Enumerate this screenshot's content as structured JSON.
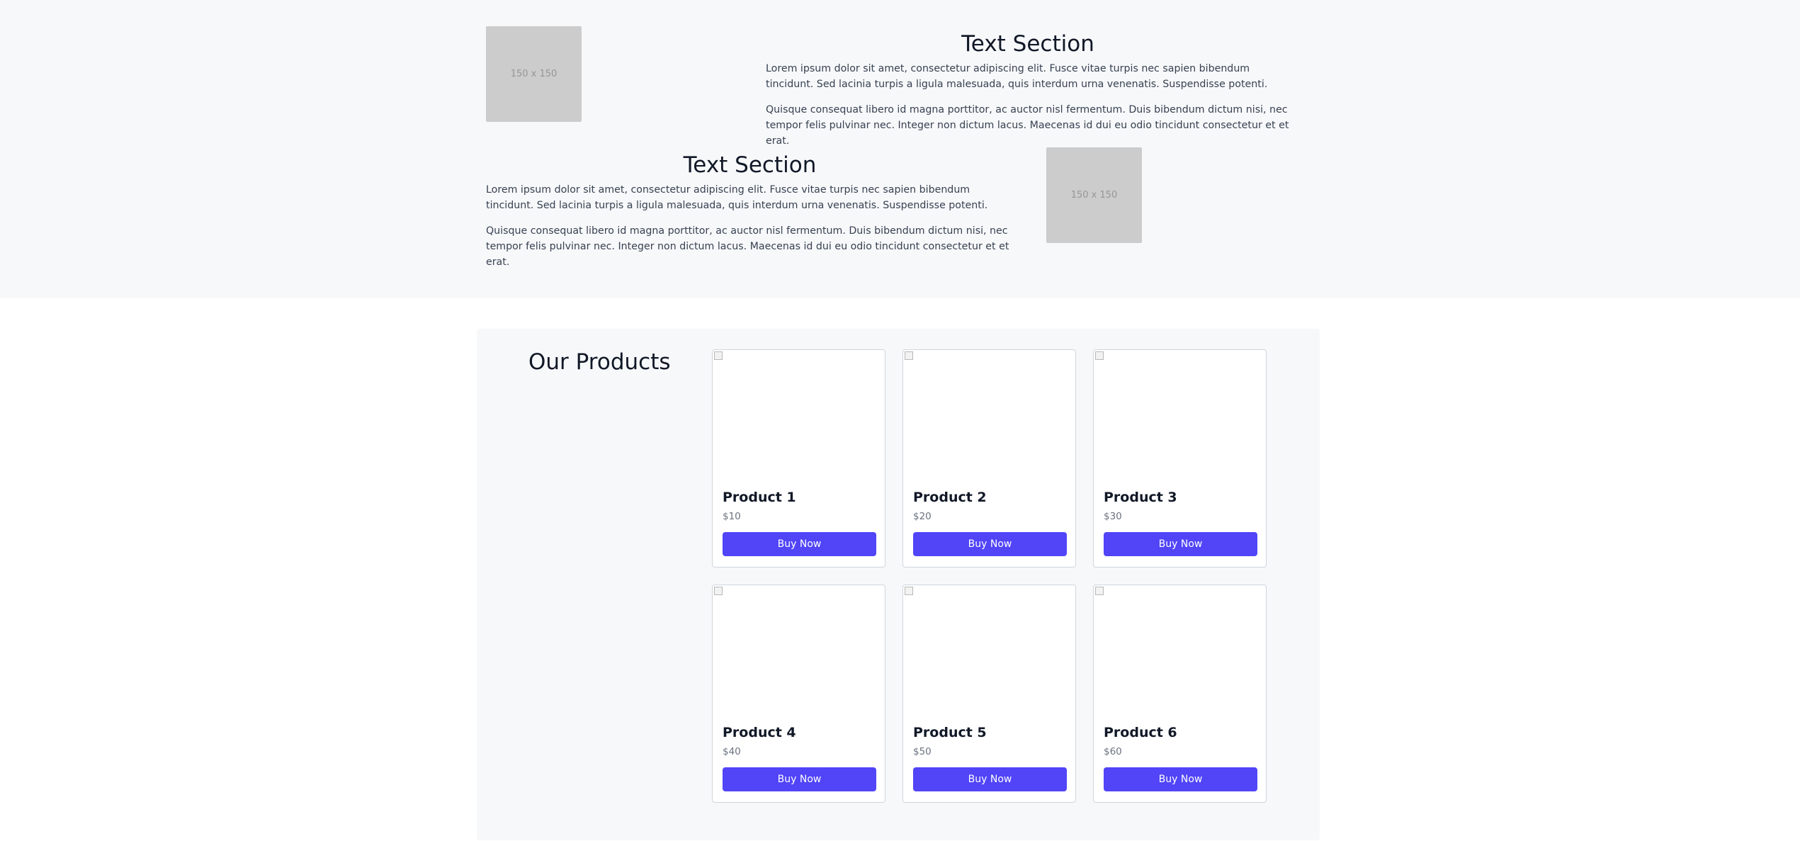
{
  "sections": [
    {
      "placeholder_label": "150 x 150",
      "heading": "Text Section",
      "paragraphs": [
        "Lorem ipsum dolor sit amet, consectetur adipiscing elit. Fusce vitae turpis nec sapien bibendum tincidunt. Sed lacinia turpis a ligula malesuada, quis interdum urna venenatis. Suspendisse potenti.",
        "Quisque consequat libero id magna porttitor, ac auctor nisl fermentum. Duis bibendum dictum nisi, nec tempor felis pulvinar nec. Integer non dictum lacus. Maecenas id dui eu odio tincidunt consectetur et et erat."
      ]
    },
    {
      "placeholder_label": "150 x 150",
      "heading": "Text Section",
      "paragraphs": [
        "Lorem ipsum dolor sit amet, consectetur adipiscing elit. Fusce vitae turpis nec sapien bibendum tincidunt. Sed lacinia turpis a ligula malesuada, quis interdum urna venenatis. Suspendisse potenti.",
        "Quisque consequat libero id magna porttitor, ac auctor nisl fermentum. Duis bibendum dictum nisi, nec tempor felis pulvinar nec. Integer non dictum lacus. Maecenas id dui eu odio tincidunt consectetur et et erat."
      ]
    }
  ],
  "products": {
    "title": "Our Products",
    "items": [
      {
        "name": "Product 1",
        "price": "$10",
        "button_label": "Buy Now"
      },
      {
        "name": "Product 2",
        "price": "$20",
        "button_label": "Buy Now"
      },
      {
        "name": "Product 3",
        "price": "$30",
        "button_label": "Buy Now"
      },
      {
        "name": "Product 4",
        "price": "$40",
        "button_label": "Buy Now"
      },
      {
        "name": "Product 5",
        "price": "$50",
        "button_label": "Buy Now"
      },
      {
        "name": "Product 6",
        "price": "$60",
        "button_label": "Buy Now"
      }
    ]
  },
  "colors": {
    "band_background": "#f7f8fa",
    "placeholder": "#cccccc",
    "button": "#5145f7",
    "text": "#111827"
  }
}
